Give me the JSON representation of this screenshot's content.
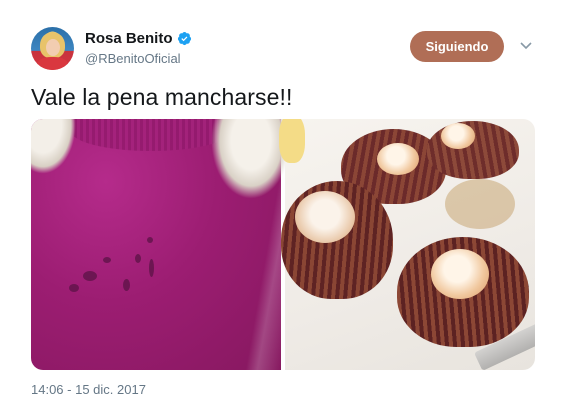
{
  "user": {
    "display_name": "Rosa Benito",
    "handle": "@RBenitoOficial",
    "verified": true
  },
  "actions": {
    "follow_label": "Siguiendo"
  },
  "tweet": {
    "text": "Vale la pena mancharse!!",
    "timestamp": "14:06 - 15 dic. 2017",
    "media": [
      {
        "subject": "magenta-sweater-stain-photo"
      },
      {
        "subject": "scallops-plate-photo"
      }
    ]
  },
  "colors": {
    "follow_button": "#b06e56",
    "verified_badge": "#1da1f2",
    "secondary_text": "#657786",
    "primary_text": "#14171a"
  },
  "icons": {
    "verified": "verified-icon",
    "more": "chevron-down-icon"
  }
}
